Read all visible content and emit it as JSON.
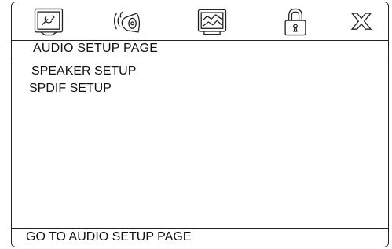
{
  "icons": [
    {
      "name": "general-setup-icon"
    },
    {
      "name": "audio-setup-icon"
    },
    {
      "name": "video-setup-icon"
    },
    {
      "name": "password-lock-icon"
    },
    {
      "name": "exit-icon"
    }
  ],
  "page_title": "AUDIO SETUP PAGE",
  "menu": {
    "items": [
      {
        "label": "SPEAKER SETUP"
      },
      {
        "label": "SPDIF SETUP"
      }
    ]
  },
  "status": {
    "text": "GO TO AUDIO SETUP PAGE"
  }
}
